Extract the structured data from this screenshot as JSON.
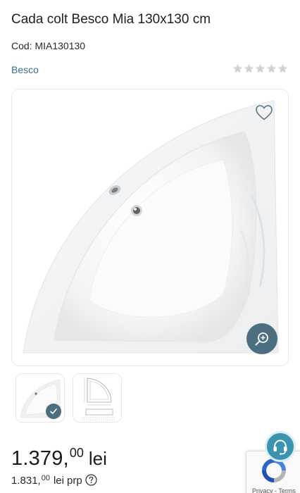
{
  "product": {
    "title": "Cada colt Besco Mia 130x130 cm",
    "code_label": "Cod: MIA130130",
    "brand": "Besco",
    "rating": 0,
    "rating_max": 5
  },
  "gallery": {
    "main_image": "corner-bathtub-photo",
    "thumbnails": [
      {
        "name": "bathtub-photo-thumb",
        "selected": true
      },
      {
        "name": "technical-drawing-thumb",
        "selected": false
      }
    ]
  },
  "price": {
    "integer": "1.379,",
    "decimals": "00",
    "currency": "lei"
  },
  "prp": {
    "integer": "1.831,",
    "decimals": "00",
    "currency": "lei",
    "label": "prp"
  },
  "recaptcha": {
    "links": "Privacy - Terms"
  },
  "icons": {
    "wishlist": "heart-icon",
    "zoom": "zoom-in-icon",
    "check": "check-icon",
    "info": "question-circle-icon",
    "support": "headset-icon"
  },
  "colors": {
    "accent": "#4c6f80",
    "brand_link": "#3a6f86",
    "support": "#3a94b0",
    "star_empty": "#cfd3d6"
  }
}
